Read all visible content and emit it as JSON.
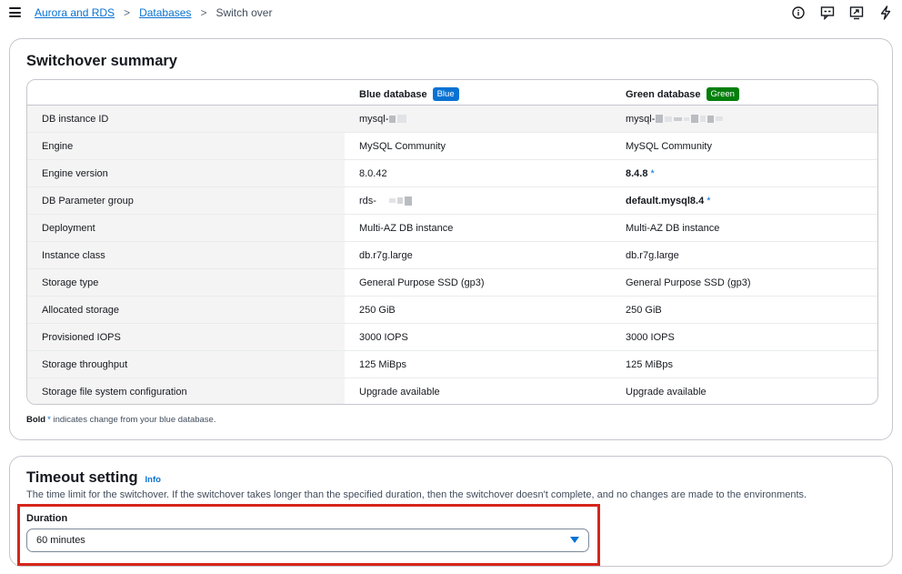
{
  "breadcrumb": {
    "items": [
      "Aurora and RDS",
      "Databases"
    ],
    "separator": ">",
    "current": "Switch over"
  },
  "top_icons": [
    "info-icon",
    "feedback-icon",
    "screen-share-icon",
    "lightning-icon"
  ],
  "summary": {
    "title": "Switchover summary",
    "columns": {
      "blue": {
        "label": "Blue database",
        "badge": "Blue",
        "badge_color": "#0972d3"
      },
      "green": {
        "label": "Green database",
        "badge": "Green",
        "badge_color": "#037f0c"
      }
    },
    "rows": [
      {
        "label": "DB instance ID",
        "blue": "mysql-",
        "green": "mysql-"
      },
      {
        "label": "Engine",
        "blue": "MySQL Community",
        "green": "MySQL Community"
      },
      {
        "label": "Engine version",
        "blue": "8.0.42",
        "green": "8.4.8",
        "green_changed": true
      },
      {
        "label": "DB Parameter group",
        "blue": "rds-",
        "green": "default.mysql8.4",
        "green_changed": true
      },
      {
        "label": "Deployment",
        "blue": "Multi-AZ DB instance",
        "green": "Multi-AZ DB instance"
      },
      {
        "label": "Instance class",
        "blue": "db.r7g.large",
        "green": "db.r7g.large"
      },
      {
        "label": "Storage type",
        "blue": "General Purpose SSD (gp3)",
        "green": "General Purpose SSD (gp3)"
      },
      {
        "label": "Allocated storage",
        "blue": "250 GiB",
        "green": "250 GiB"
      },
      {
        "label": "Provisioned IOPS",
        "blue": "3000 IOPS",
        "green": "3000 IOPS"
      },
      {
        "label": "Storage throughput",
        "blue": "125 MiBps",
        "green": "125 MiBps"
      },
      {
        "label": "Storage file system configuration",
        "blue": "Upgrade available",
        "green": "Upgrade available"
      }
    ],
    "change_marker": "*",
    "note_bold": "Bold",
    "note_text": "indicates change from your blue database."
  },
  "timeout": {
    "title": "Timeout setting",
    "info_link": "Info",
    "description": "The time limit for the switchover. If the switchover takes longer than the specified duration, then the switchover doesn't complete, and no changes are made to the environments.",
    "field_label": "Duration",
    "selected_value": "60 minutes"
  },
  "colors": {
    "accent": "#0972d3",
    "highlight_border": "#d6261c"
  }
}
